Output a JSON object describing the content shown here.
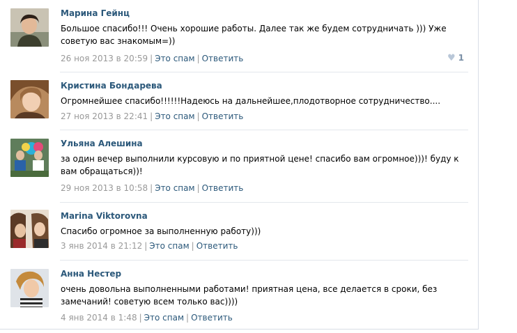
{
  "comments": [
    {
      "author": "Марина Гейнц",
      "text": "Большое спасибо!!! Очень хорошие работы. Далее так же будем сотрудничать ))) Уже советую вас знакомым=))",
      "date": "26 ноя 2013 в 20:59",
      "spam_label": "Это спам",
      "reply_label": "Ответить",
      "likes": "1"
    },
    {
      "author": "Кристина Бондарева",
      "text": "Огромнейшее спасибо!!!!!!Надеюсь на дальнейшее,плодотворное сотрудничество....",
      "date": "27 ноя 2013 в 22:41",
      "spam_label": "Это спам",
      "reply_label": "Ответить"
    },
    {
      "author": "Ульяна Алешина",
      "text": "за один вечер выполнили курсовую и по приятной цене! спасибо вам огромное)))! буду к вам обращаться))!",
      "date": "29 ноя 2013 в 10:58",
      "spam_label": "Это спам",
      "reply_label": "Ответить"
    },
    {
      "author": "Marina Viktorovna",
      "text": "Спасибо огромное за выполненную работу)))",
      "date": "3 янв 2014 в 21:12",
      "spam_label": "Это спам",
      "reply_label": "Ответить"
    },
    {
      "author": "Анна Нестер",
      "text": "очень довольна выполненными работами! приятная цена, все делается в сроки, без замечаний! советую всем только вас))))",
      "date": "4 янв 2014 в 1:48",
      "spam_label": "Это спам",
      "reply_label": "Ответить"
    }
  ],
  "icons": {
    "like": "heart-icon"
  },
  "colors": {
    "link": "#2b587a",
    "meta": "#999999",
    "like": "#7a8fa6"
  }
}
